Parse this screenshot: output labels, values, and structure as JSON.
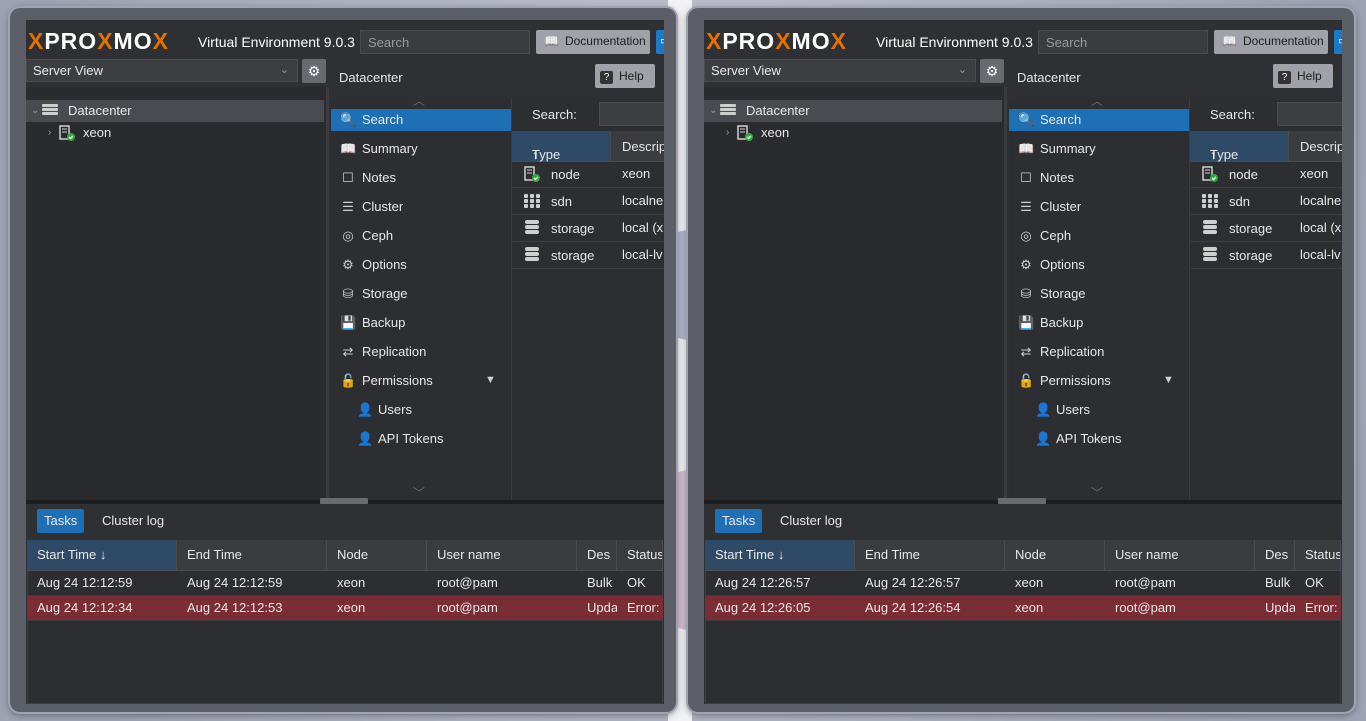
{
  "windows": [
    {
      "header": {
        "logo": {
          "p": "PRO",
          "x1": "X",
          "m": "MO",
          "x2": "X"
        },
        "version": "Virtual Environment 9.0.3",
        "search_placeholder": "Search",
        "doc_label": "Documentation"
      },
      "view_select": "Server View",
      "tree": {
        "datacenter": "Datacenter",
        "node": "xeon"
      },
      "panel_title": "Datacenter",
      "help_label": "Help",
      "nav": [
        "Search",
        "Summary",
        "Notes",
        "Cluster",
        "Ceph",
        "Options",
        "Storage",
        "Backup",
        "Replication",
        "Permissions",
        "Users",
        "API Tokens"
      ],
      "grid": {
        "search_label": "Search:",
        "col_type": "Type",
        "col_desc": "Descrip",
        "rows": [
          {
            "type": "node",
            "desc": "xeon"
          },
          {
            "type": "sdn",
            "desc": "localne"
          },
          {
            "type": "storage",
            "desc": "local (x"
          },
          {
            "type": "storage",
            "desc": "local-lv"
          }
        ]
      },
      "tabs": {
        "tasks": "Tasks",
        "cluster_log": "Cluster log"
      },
      "task_columns": [
        "Start Time",
        "End Time",
        "Node",
        "User name",
        "Des",
        "Status"
      ],
      "tasks": [
        {
          "start": "Aug 24 12:12:59",
          "end": "Aug 24 12:12:59",
          "node": "xeon",
          "user": "root@pam",
          "desc": "Bulk",
          "status": "OK"
        },
        {
          "start": "Aug 24 12:12:34",
          "end": "Aug 24 12:12:53",
          "node": "xeon",
          "user": "root@pam",
          "desc": "Upda",
          "status": "Error:"
        }
      ]
    },
    {
      "header": {
        "logo": {
          "p": "PRO",
          "x1": "X",
          "m": "MO",
          "x2": "X"
        },
        "version": "Virtual Environment 9.0.3",
        "search_placeholder": "Search",
        "doc_label": "Documentation"
      },
      "view_select": "Server View",
      "tree": {
        "datacenter": "Datacenter",
        "node": "xeon"
      },
      "panel_title": "Datacenter",
      "help_label": "Help",
      "nav": [
        "Search",
        "Summary",
        "Notes",
        "Cluster",
        "Ceph",
        "Options",
        "Storage",
        "Backup",
        "Replication",
        "Permissions",
        "Users",
        "API Tokens"
      ],
      "grid": {
        "search_label": "Search:",
        "col_type": "Type",
        "col_desc": "Descrip",
        "rows": [
          {
            "type": "node",
            "desc": "xeon"
          },
          {
            "type": "sdn",
            "desc": "localne"
          },
          {
            "type": "storage",
            "desc": "local (x"
          },
          {
            "type": "storage",
            "desc": "local-lv"
          }
        ]
      },
      "tabs": {
        "tasks": "Tasks",
        "cluster_log": "Cluster log"
      },
      "task_columns": [
        "Start Time",
        "End Time",
        "Node",
        "User name",
        "Des",
        "Status"
      ],
      "tasks": [
        {
          "start": "Aug 24 12:26:57",
          "end": "Aug 24 12:26:57",
          "node": "xeon",
          "user": "root@pam",
          "desc": "Bulk",
          "status": "OK"
        },
        {
          "start": "Aug 24 12:26:05",
          "end": "Aug 24 12:26:54",
          "node": "xeon",
          "user": "root@pam",
          "desc": "Upda",
          "status": "Error:"
        }
      ]
    }
  ],
  "colors": {
    "accent": "#1f6fb5",
    "brand_orange": "#e57000",
    "error_row": "#7a2d35"
  }
}
